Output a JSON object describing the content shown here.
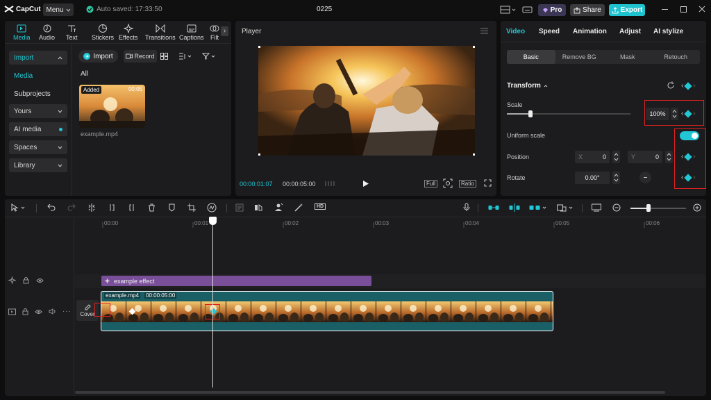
{
  "titlebar": {
    "logo": "CapCut",
    "menu": "Menu",
    "autosave": "Auto saved: 17:33:50",
    "project_name": "0225",
    "pro": "Pro",
    "share": "Share",
    "export": "Export"
  },
  "media_tabs": [
    {
      "label": "Media",
      "icon": "media-icon"
    },
    {
      "label": "Audio",
      "icon": "audio-icon"
    },
    {
      "label": "Text",
      "icon": "text-icon"
    },
    {
      "label": "Stickers",
      "icon": "stickers-icon"
    },
    {
      "label": "Effects",
      "icon": "effects-icon"
    },
    {
      "label": "Transitions",
      "icon": "transitions-icon"
    },
    {
      "label": "Captions",
      "icon": "captions-icon"
    },
    {
      "label": "Filt",
      "icon": "filters-icon"
    }
  ],
  "sidebar": {
    "import": "Import",
    "media": "Media",
    "subprojects": "Subprojects",
    "yours": "Yours",
    "ai_media": "AI media",
    "spaces": "Spaces",
    "library": "Library"
  },
  "media_panel": {
    "import_btn": "Import",
    "record_btn": "Record",
    "filter_all": "All",
    "clip_badge": "Added",
    "clip_duration": "00:05",
    "clip_name": "example.mp4"
  },
  "player": {
    "title": "Player",
    "current_time": "00:00:01:07",
    "total_time": "00:00:05:00",
    "full": "Full",
    "ratio": "Ratio"
  },
  "inspector": {
    "tabs": [
      "Video",
      "Speed",
      "Animation",
      "Adjust",
      "AI stylize"
    ],
    "subtabs": [
      "Basic",
      "Remove BG",
      "Mask",
      "Retouch"
    ],
    "transform": "Transform",
    "scale_label": "Scale",
    "scale_value": "100%",
    "scale_fraction": 0.19,
    "uniform_scale": "Uniform scale",
    "position_label": "Position",
    "pos_x_label": "X",
    "pos_x": "0",
    "pos_y_label": "Y",
    "pos_y": "0",
    "rotate_label": "Rotate",
    "rotate_value": "0.00°"
  },
  "timeline": {
    "ruler": [
      "00:00",
      "00:02",
      "00:03",
      "00:04",
      "00:05",
      "00:06",
      "00:01"
    ],
    "effect_clip": "example effect",
    "video_clip": "example.mp4",
    "video_duration": "00:00:05:00",
    "cover": "Cover"
  },
  "colors": {
    "accent": "#21c7d4",
    "effect": "#7a4f9a",
    "video_track": "#1a5f66",
    "highlight": "#e02020"
  }
}
